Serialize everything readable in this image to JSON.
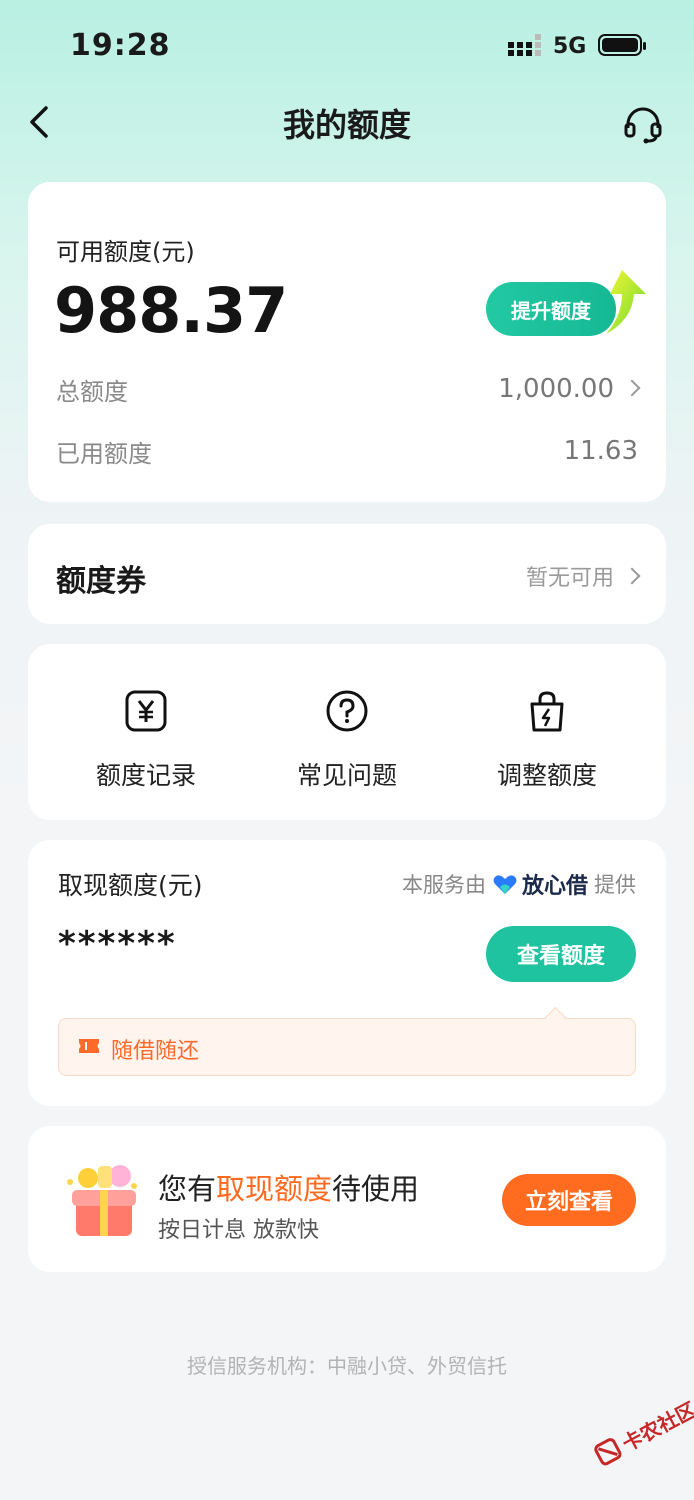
{
  "status_bar": {
    "time": "19:28",
    "network": "5G"
  },
  "nav": {
    "title": "我的额度"
  },
  "credit": {
    "available_label": "可用额度(元)",
    "available_amount": "988.37",
    "raise_label": "提升额度",
    "total_label": "总额度",
    "total_value": "1,000.00",
    "used_label": "已用额度",
    "used_value": "11.63"
  },
  "coupon": {
    "title": "额度券",
    "status": "暂无可用"
  },
  "quick_actions": [
    {
      "label": "额度记录",
      "icon": "yuan-icon"
    },
    {
      "label": "常见问题",
      "icon": "question-icon"
    },
    {
      "label": "调整额度",
      "icon": "bag-lightning-icon"
    }
  ],
  "cash": {
    "label": "取现额度(元)",
    "provider_prefix": "本服务由",
    "provider_name": "放心借",
    "provider_suffix": "提供",
    "masked_amount": "******",
    "view_label": "查看额度",
    "tip": "随借随还"
  },
  "promo": {
    "title_prefix": "您有",
    "title_highlight": "取现额度",
    "title_suffix": "待使用",
    "subtitle": "按日计息 放款快",
    "button": "立刻查看"
  },
  "footer": {
    "text": "授信服务机构：中融小贷、外贸信托"
  },
  "watermark": {
    "text": "卡农社区"
  },
  "colors": {
    "accent": "#1fc3a0",
    "orange": "#ff6b1f",
    "tip_text": "#ff6a2a"
  }
}
